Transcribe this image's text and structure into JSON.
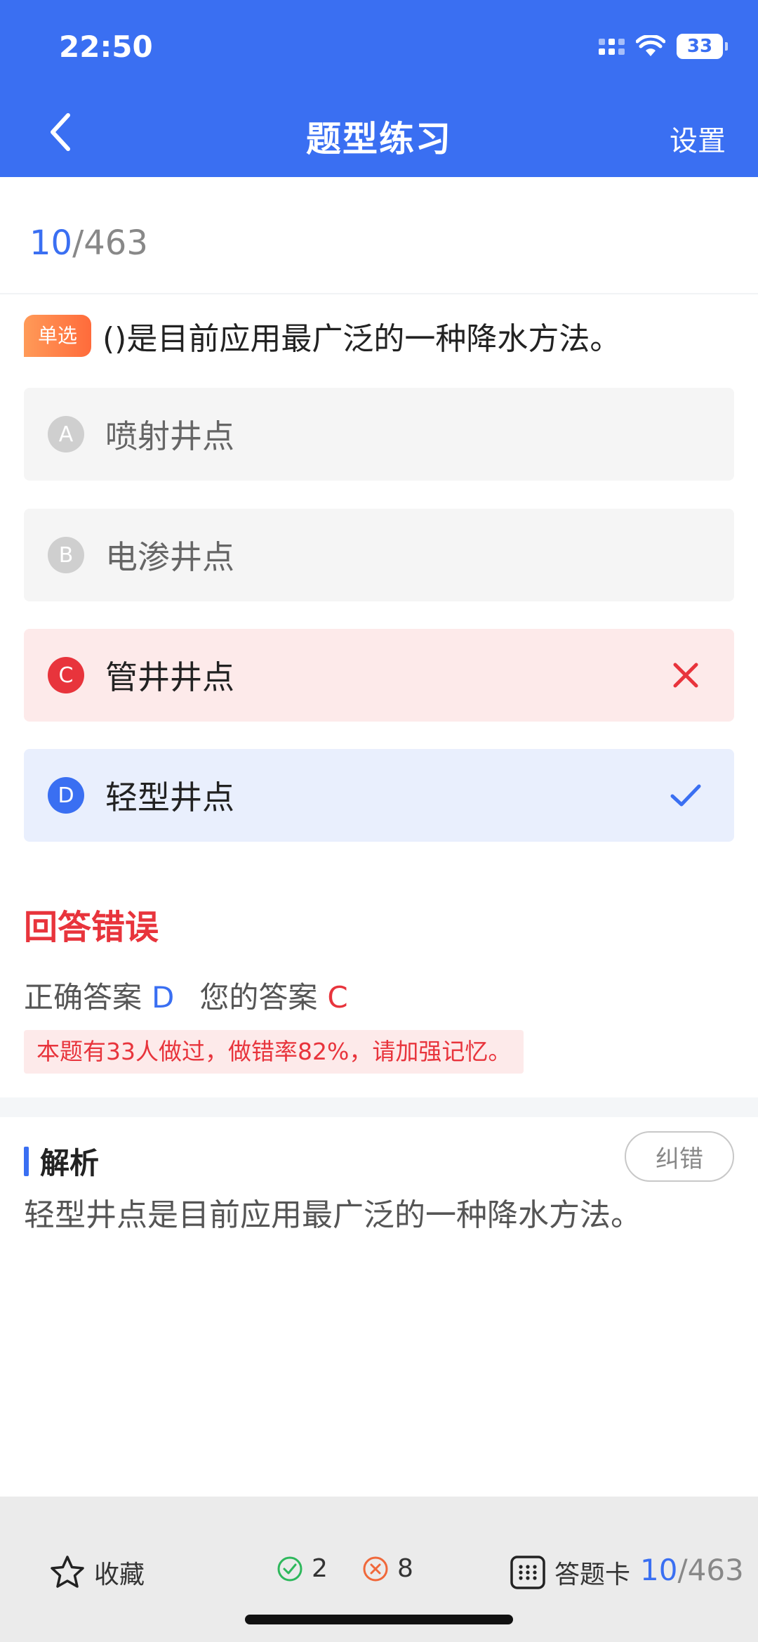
{
  "status_bar": {
    "time": "22:50",
    "battery": "33"
  },
  "nav": {
    "title": "题型练习",
    "settings_label": "设置"
  },
  "progress": {
    "current": "10",
    "total": "/463"
  },
  "question": {
    "type_tag": "单选",
    "text": "()是目前应用最广泛的一种降水方法。"
  },
  "options": [
    {
      "letter": "A",
      "text": "喷射井点",
      "state": "neutral"
    },
    {
      "letter": "B",
      "text": "电渗井点",
      "state": "neutral"
    },
    {
      "letter": "C",
      "text": "管井井点",
      "state": "wrong"
    },
    {
      "letter": "D",
      "text": "轻型井点",
      "state": "correct"
    }
  ],
  "result": {
    "title": "回答错误",
    "correct_label": "正确答案",
    "correct_value": "D",
    "yours_label": "您的答案",
    "yours_value": "C",
    "stat_note": "本题有33人做过，做错率82%，请加强记忆。"
  },
  "analysis": {
    "title": "解析",
    "report_label": "纠错",
    "text": "轻型井点是目前应用最广泛的一种降水方法。"
  },
  "bottom_bar": {
    "favorite_label": "收藏",
    "correct_count": "2",
    "wrong_count": "8",
    "answer_card_label": "答题卡",
    "current": "10",
    "total": "/463"
  },
  "colors": {
    "primary": "#3A6FF2",
    "error": "#E8343C",
    "tag_orange": "#FF7A45"
  },
  "icons": [
    "back-chevron-icon",
    "wifi-icon",
    "signal-icon",
    "battery-icon",
    "cross-icon",
    "check-icon",
    "star-icon",
    "check-circle-icon",
    "x-circle-icon",
    "grid-icon"
  ]
}
